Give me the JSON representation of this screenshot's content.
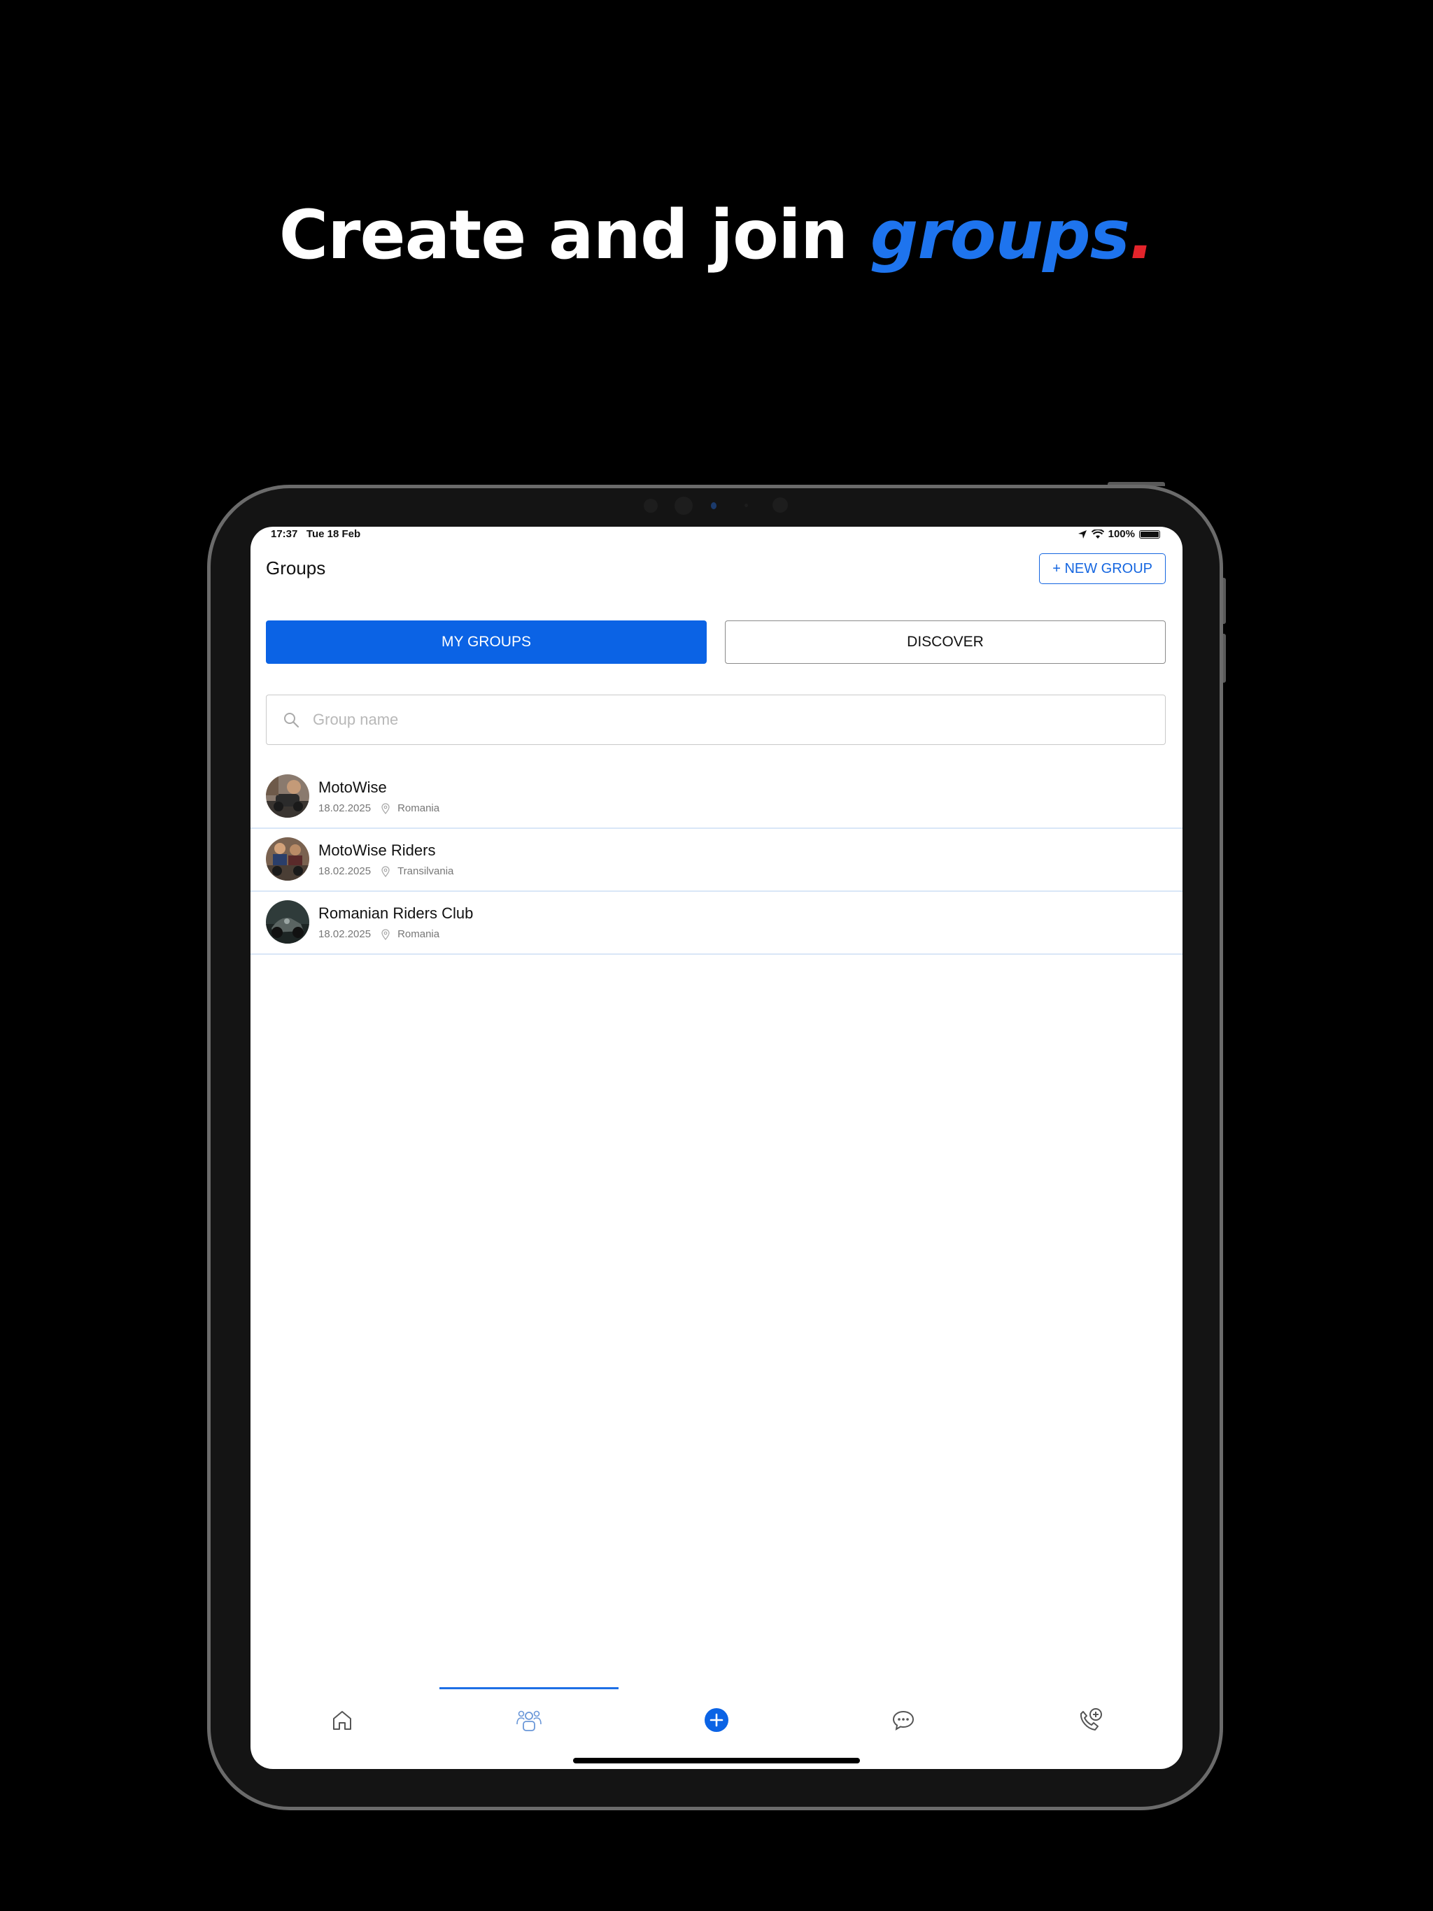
{
  "headline": {
    "prefix": "Create and join ",
    "accent": "groups",
    "suffix": "."
  },
  "status_bar": {
    "time": "17:37",
    "date": "Tue 18 Feb",
    "battery": "100%"
  },
  "header": {
    "title": "Groups",
    "new_group_label": "+ NEW GROUP"
  },
  "tabs": {
    "my_groups": "MY GROUPS",
    "discover": "DISCOVER",
    "active": "MY GROUPS"
  },
  "search": {
    "placeholder": "Group name",
    "value": ""
  },
  "groups": [
    {
      "name": "MotoWise",
      "date": "18.02.2025",
      "location": "Romania"
    },
    {
      "name": "MotoWise Riders",
      "date": "18.02.2025",
      "location": "Transilvania"
    },
    {
      "name": "Romanian Riders Club",
      "date": "18.02.2025",
      "location": "Romania"
    }
  ],
  "bottom_nav": {
    "items": [
      {
        "icon": "home-icon"
      },
      {
        "icon": "groups-icon",
        "active": true
      },
      {
        "icon": "add-circle-icon"
      },
      {
        "icon": "chat-icon"
      },
      {
        "icon": "emergency-call-icon"
      }
    ]
  },
  "colors": {
    "accent": "#0b63e5",
    "headline_accent": "#1e74ee",
    "headline_dot": "#e3242b",
    "divider": "#d9e6f7"
  }
}
